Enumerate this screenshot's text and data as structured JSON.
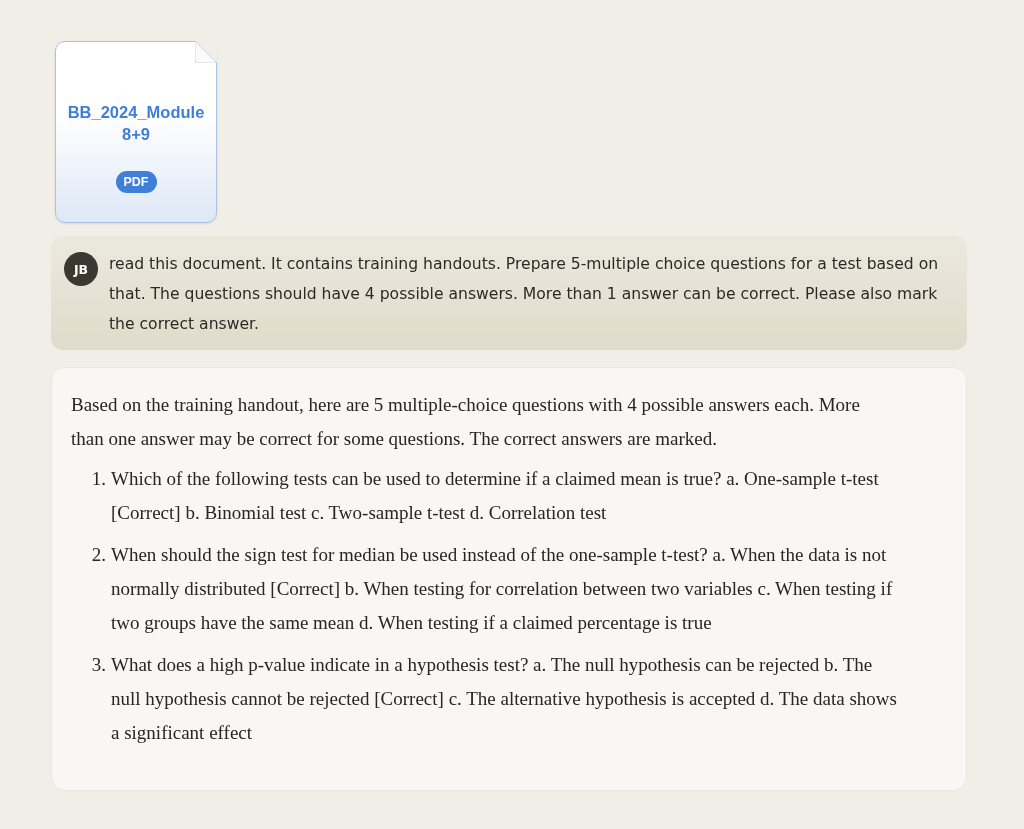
{
  "attachment": {
    "file_name": "BB_2024_Module 8+9",
    "file_type": "PDF"
  },
  "user_message": {
    "avatar": "JB",
    "text": "read this document. It contains training handouts. Prepare 5-multiple choice questions for a test based on that. The questions should have 4 possible answers. More than 1 answer can be correct. Please also mark the correct answer."
  },
  "response": {
    "intro": "Based on the training handout, here are 5 multiple-choice questions with 4 possible answers each. More than one answer may be correct for some questions. The correct answers are marked.",
    "items": [
      {
        "number": "1.",
        "text": "Which of the following tests can be used to determine if a claimed mean is true? a. One-sample t-test [Correct] b. Binomial test c. Two-sample t-test d. Correlation test"
      },
      {
        "number": "2.",
        "text": "When should the sign test for median be used instead of the one-sample t-test? a. When the data is not normally distributed [Correct] b. When testing for correlation between two variables c. When testing if two groups have the same mean d. When testing if a claimed percentage is true"
      },
      {
        "number": "3.",
        "text": "What does a high p-value indicate in a hypothesis test? a. The null hypothesis can be rejected b. The null hypothesis cannot be rejected [Correct] c. The alternative hypothesis is accepted d. The data shows a significant effect"
      }
    ]
  }
}
